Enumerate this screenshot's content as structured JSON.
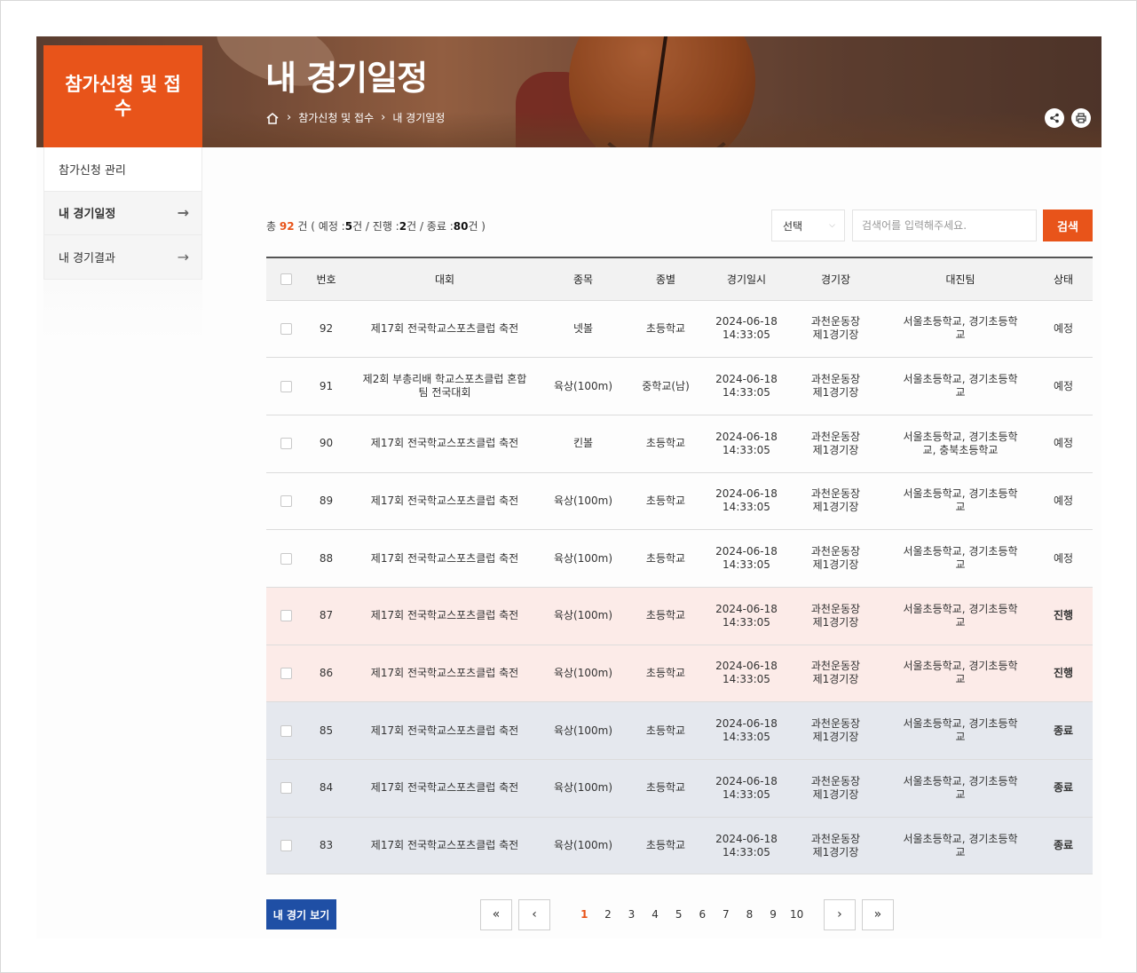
{
  "banner": {
    "title": "내 경기일정",
    "breadcrumb": [
      "참가신청 및 접수",
      "내 경기일정"
    ]
  },
  "sidebar": {
    "heading": "참가신청 및 접수",
    "items": [
      {
        "label": "참가신청 관리"
      },
      {
        "label": "내 경기일정"
      },
      {
        "label": "내 경기결과"
      }
    ]
  },
  "summary": {
    "prefix": "총",
    "total": "92",
    "unit": "건",
    "planned_label": "( 예정 :",
    "planned": "5",
    "ongoing_label": "건 / 진행 :",
    "ongoing": "2",
    "done_label": "건 / 종료 :",
    "done": "80",
    "suffix": "건 )"
  },
  "search": {
    "select_value": "선택",
    "placeholder": "검색어를 입력해주세요.",
    "button": "검색"
  },
  "table": {
    "headers": [
      "번호",
      "대회",
      "종목",
      "종별",
      "경기일시",
      "경기장",
      "대진팀",
      "상태"
    ],
    "rows": [
      {
        "no": "92",
        "event": "제17회 전국학교스포츠클럽 축전",
        "sport": "넷볼",
        "division": "초등학교",
        "date": "2024-06-18",
        "time": "14:33:05",
        "venue1": "과천운동장",
        "venue2": "제1경기장",
        "teams": "서울초등학교, 경기초등학교",
        "status": "예정",
        "kind": "planned"
      },
      {
        "no": "91",
        "event": "제2회 부총리배 학교스포츠클럽 혼합팀 전국대회",
        "sport": "육상(100m)",
        "division": "중학교(남)",
        "date": "2024-06-18",
        "time": "14:33:05",
        "venue1": "과천운동장",
        "venue2": "제1경기장",
        "teams": "서울초등학교, 경기초등학교",
        "status": "예정",
        "kind": "planned"
      },
      {
        "no": "90",
        "event": "제17회 전국학교스포츠클럽 축전",
        "sport": "킨볼",
        "division": "초등학교",
        "date": "2024-06-18",
        "time": "14:33:05",
        "venue1": "과천운동장",
        "venue2": "제1경기장",
        "teams": "서울초등학교, 경기초등학교, 충북초등학교",
        "status": "예정",
        "kind": "planned"
      },
      {
        "no": "89",
        "event": "제17회 전국학교스포츠클럽 축전",
        "sport": "육상(100m)",
        "division": "초등학교",
        "date": "2024-06-18",
        "time": "14:33:05",
        "venue1": "과천운동장",
        "venue2": "제1경기장",
        "teams": "서울초등학교, 경기초등학교",
        "status": "예정",
        "kind": "planned"
      },
      {
        "no": "88",
        "event": "제17회 전국학교스포츠클럽 축전",
        "sport": "육상(100m)",
        "division": "초등학교",
        "date": "2024-06-18",
        "time": "14:33:05",
        "venue1": "과천운동장",
        "venue2": "제1경기장",
        "teams": "서울초등학교, 경기초등학교",
        "status": "예정",
        "kind": "planned"
      },
      {
        "no": "87",
        "event": "제17회 전국학교스포츠클럽 축전",
        "sport": "육상(100m)",
        "division": "초등학교",
        "date": "2024-06-18",
        "time": "14:33:05",
        "venue1": "과천운동장",
        "venue2": "제1경기장",
        "teams": "서울초등학교, 경기초등학교",
        "status": "진행",
        "kind": "ongoing"
      },
      {
        "no": "86",
        "event": "제17회 전국학교스포츠클럽 축전",
        "sport": "육상(100m)",
        "division": "초등학교",
        "date": "2024-06-18",
        "time": "14:33:05",
        "venue1": "과천운동장",
        "venue2": "제1경기장",
        "teams": "서울초등학교, 경기초등학교",
        "status": "진행",
        "kind": "ongoing"
      },
      {
        "no": "85",
        "event": "제17회 전국학교스포츠클럽 축전",
        "sport": "육상(100m)",
        "division": "초등학교",
        "date": "2024-06-18",
        "time": "14:33:05",
        "venue1": "과천운동장",
        "venue2": "제1경기장",
        "teams": "서울초등학교, 경기초등학교",
        "status": "종료",
        "kind": "done"
      },
      {
        "no": "84",
        "event": "제17회 전국학교스포츠클럽 축전",
        "sport": "육상(100m)",
        "division": "초등학교",
        "date": "2024-06-18",
        "time": "14:33:05",
        "venue1": "과천운동장",
        "venue2": "제1경기장",
        "teams": "서울초등학교, 경기초등학교",
        "status": "종료",
        "kind": "done"
      },
      {
        "no": "83",
        "event": "제17회 전국학교스포츠클럽 축전",
        "sport": "육상(100m)",
        "division": "초등학교",
        "date": "2024-06-18",
        "time": "14:33:05",
        "venue1": "과천운동장",
        "venue2": "제1경기장",
        "teams": "서울초등학교, 경기초등학교",
        "status": "종료",
        "kind": "done"
      }
    ]
  },
  "bottom": {
    "my_games_button": "내 경기 보기"
  },
  "pagination": {
    "first": "«",
    "prev": "‹",
    "next": "›",
    "last": "»",
    "pages": [
      "1",
      "2",
      "3",
      "4",
      "5",
      "6",
      "7",
      "8",
      "9",
      "10"
    ],
    "current": "1"
  },
  "colors": {
    "accent": "#e8541a",
    "primary_button": "#1f4fa5",
    "ongoing_row": "#fcebe8",
    "done_row": "#e5e8ee",
    "ongoing_text": "#d02828",
    "done_text": "#1a2e5a"
  },
  "icons": {
    "home": "home-icon",
    "share": "share-icon",
    "print": "print-icon",
    "menu_arrow": "arrow-right-icon"
  }
}
